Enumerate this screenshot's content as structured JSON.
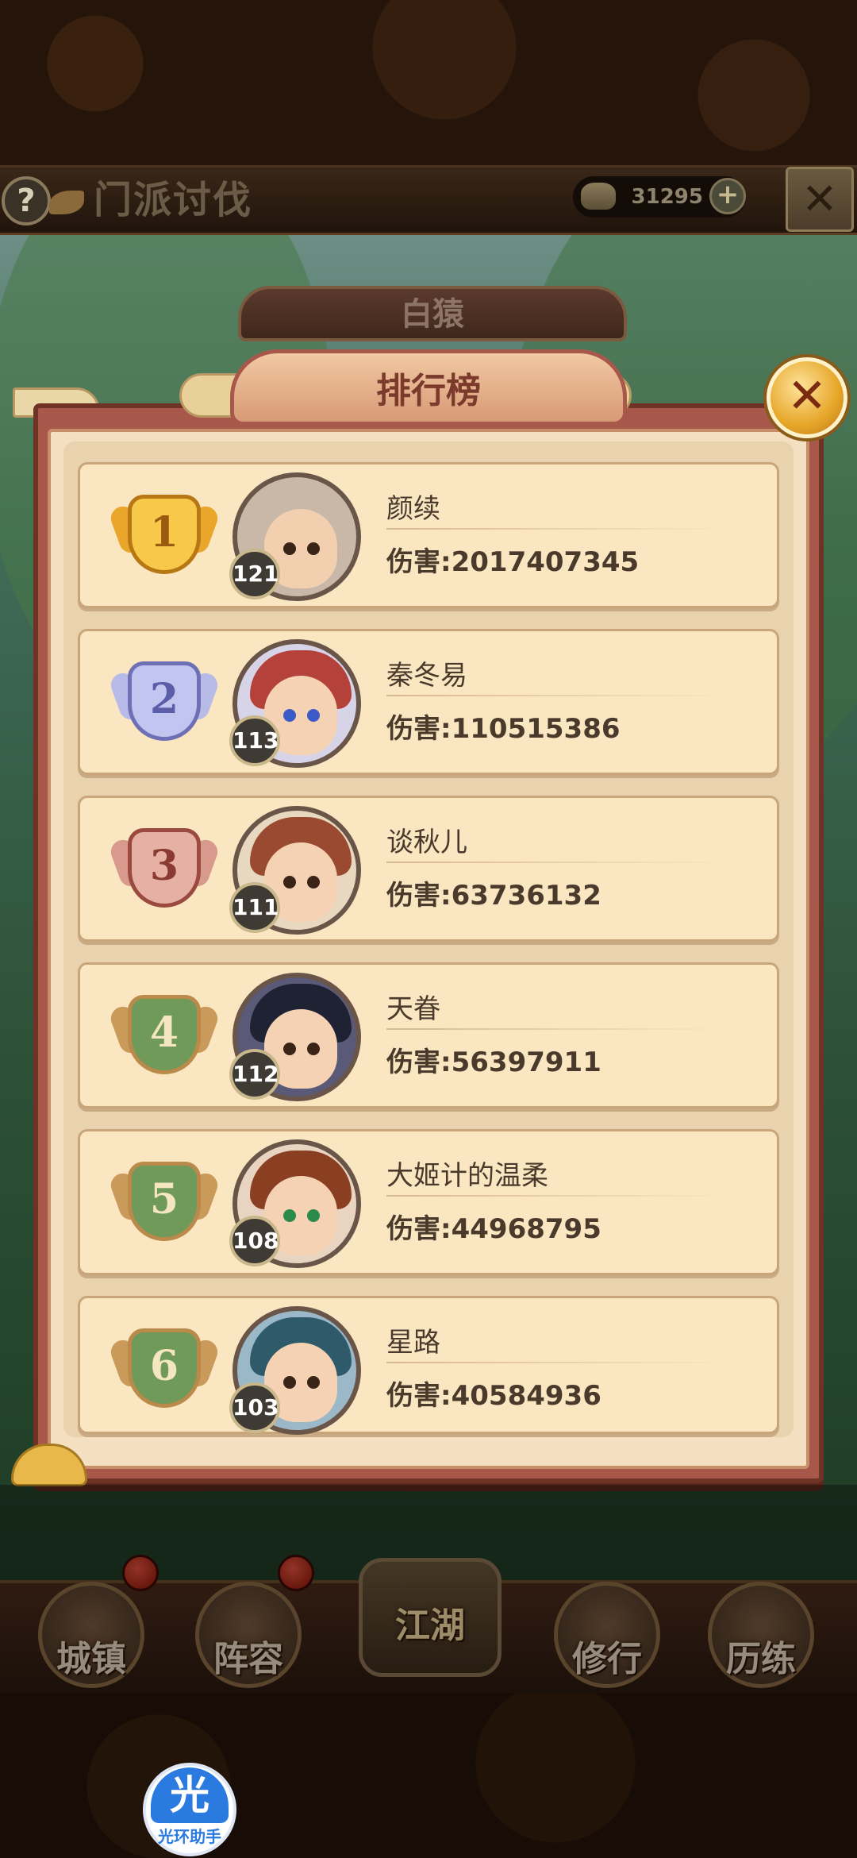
{
  "header": {
    "title": "门派讨伐",
    "currency_value": "31295",
    "help_symbol": "?",
    "plus_symbol": "+",
    "close_symbol": "✕"
  },
  "boss": {
    "name": "白猿"
  },
  "dialog": {
    "title": "排行榜",
    "close_symbol": "✕"
  },
  "rankings": [
    {
      "rank": "1",
      "level": "121",
      "name": "颜续",
      "damage": "伤害:2017407345"
    },
    {
      "rank": "2",
      "level": "113",
      "name": "秦冬易",
      "damage": "伤害:110515386"
    },
    {
      "rank": "3",
      "level": "111",
      "name": "谈秋儿",
      "damage": "伤害:63736132"
    },
    {
      "rank": "4",
      "level": "112",
      "name": "天眷",
      "damage": "伤害:56397911"
    },
    {
      "rank": "5",
      "level": "108",
      "name": "大姬计的温柔",
      "damage": "伤害:44968795"
    },
    {
      "rank": "6",
      "level": "103",
      "name": "星路",
      "damage": "伤害:40584936"
    }
  ],
  "nav": [
    {
      "label": "城镇"
    },
    {
      "label": "阵容"
    },
    {
      "label": "江湖"
    },
    {
      "label": "修行"
    },
    {
      "label": "历练"
    }
  ],
  "assistant": {
    "glyph": "光",
    "label": "光环助手"
  },
  "colors": {
    "medal_gold": "#e9a62a",
    "medal_silver": "#9b9fd8",
    "medal_bronze": "#c9746a",
    "medal_plain": "#b98a4a",
    "panel_red": "#a8584a",
    "row_bg": "#fbe6c2"
  }
}
